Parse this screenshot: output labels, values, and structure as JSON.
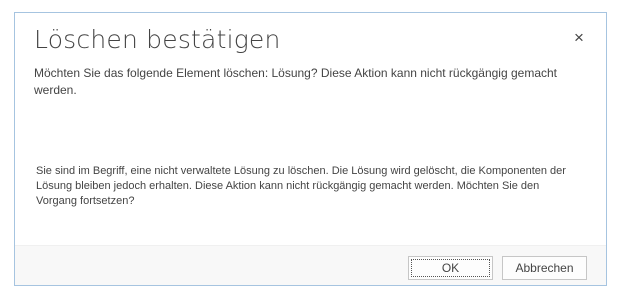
{
  "dialog": {
    "title": "Löschen bestätigen",
    "close_icon": "×",
    "subtitle": "Möchten Sie das folgende Element löschen: Lösung? Diese Aktion kann nicht rückgängig gemacht werden.",
    "body": "Sie sind im Begriff, eine nicht verwaltete Lösung zu löschen. Die Lösung wird gelöscht, die Komponenten der Lösung bleiben jedoch erhalten. Diese Aktion kann nicht rückgängig gemacht werden. Möchten Sie den Vorgang fortsetzen?",
    "buttons": {
      "ok_label": "OK",
      "cancel_label": "Abbrechen"
    }
  },
  "colors": {
    "border": "#a6c4e0",
    "text": "#444444",
    "footer_bg": "#f8f8f8"
  }
}
